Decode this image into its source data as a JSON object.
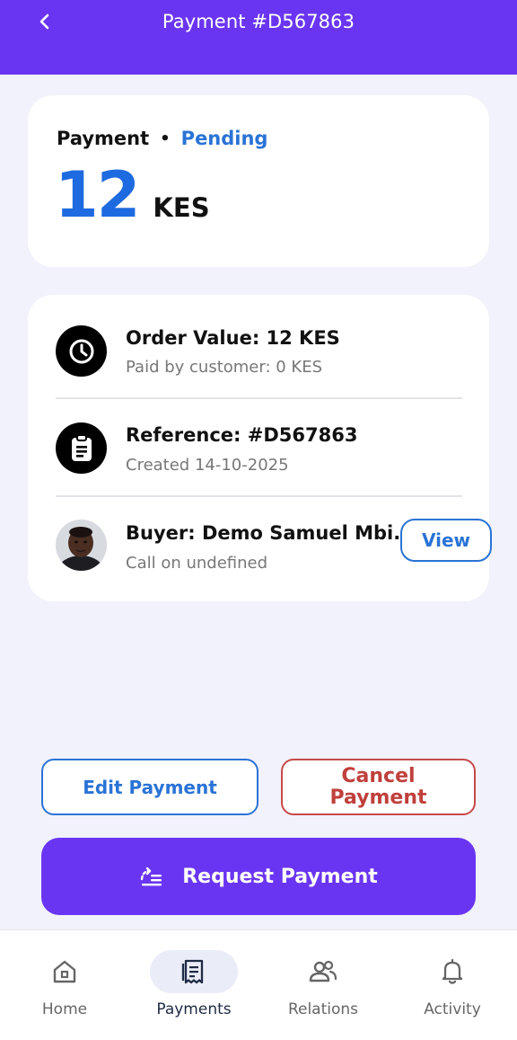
{
  "header": {
    "title": "Payment #D567863",
    "back_icon": "chevron-left-icon"
  },
  "summary": {
    "label": "Payment",
    "separator": "•",
    "status": "Pending",
    "amount": "12",
    "currency": "KES"
  },
  "details": {
    "order": {
      "title": "Order Value: 12 KES",
      "subtitle": "Paid by customer: 0 KES",
      "icon": "clock-icon"
    },
    "reference": {
      "title": "Reference: #D567863",
      "subtitle": "Created 14-10-2025",
      "icon": "clipboard-icon"
    },
    "buyer": {
      "title": "Buyer: Demo Samuel Mbi...",
      "subtitle": "Call on undefined",
      "view_label": "View"
    }
  },
  "actions": {
    "edit_label": "Edit Payment",
    "cancel_line1": "Cancel",
    "cancel_line2": "Payment",
    "request_label": "Request Payment"
  },
  "tabbar": {
    "tabs": [
      {
        "label": "Home",
        "icon": "home-icon",
        "active": false
      },
      {
        "label": "Payments",
        "icon": "receipt-icon",
        "active": true
      },
      {
        "label": "Relations",
        "icon": "people-icon",
        "active": false
      },
      {
        "label": "Activity",
        "icon": "bell-icon",
        "active": false
      }
    ]
  },
  "colors": {
    "brand": "#6a35f2",
    "accent_blue": "#2a73d6",
    "danger": "#c0403c",
    "background": "#f1f2fb"
  }
}
